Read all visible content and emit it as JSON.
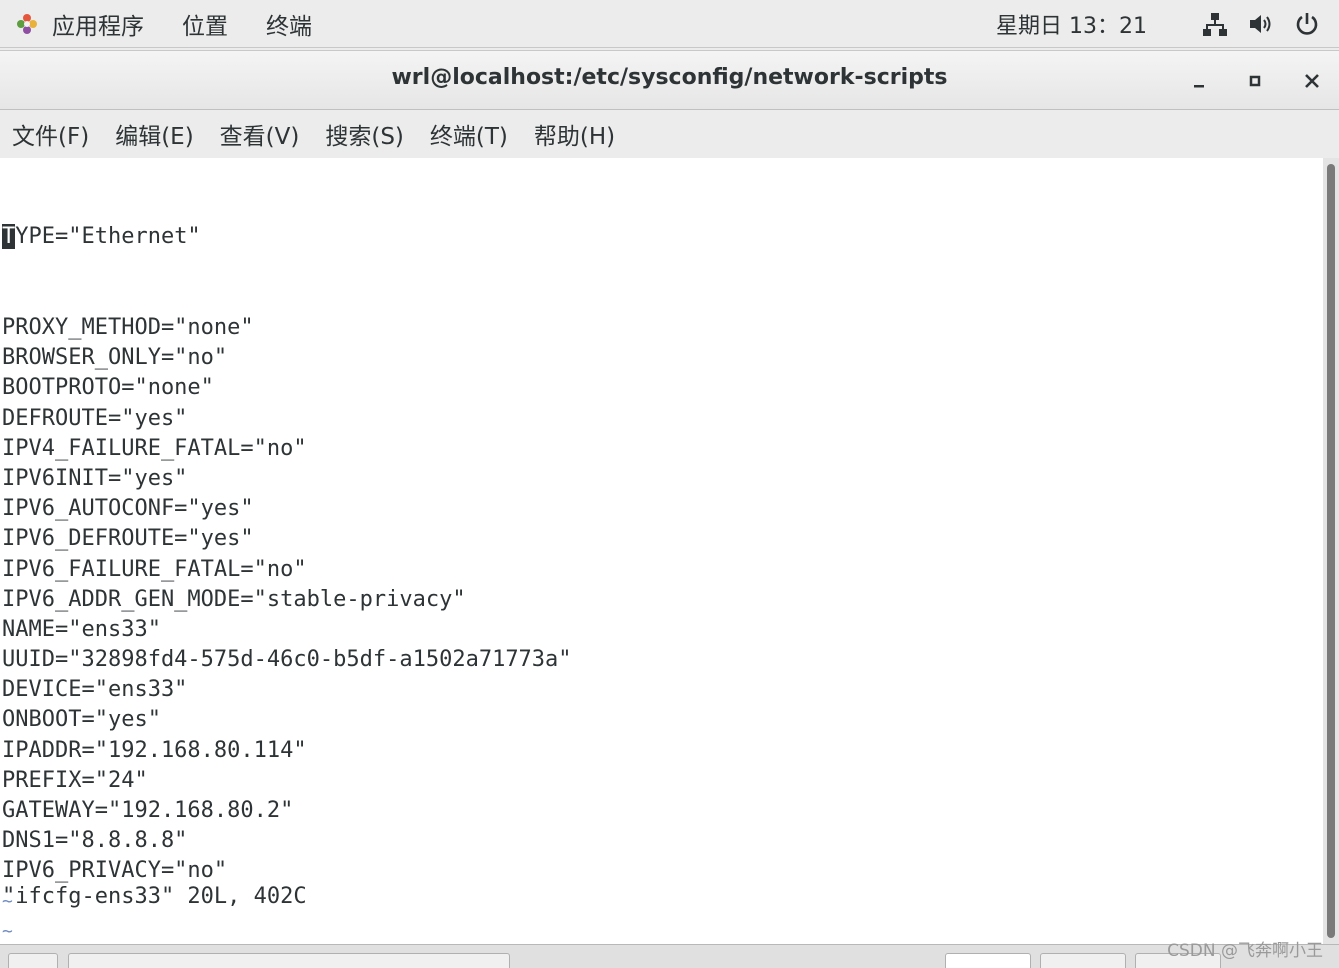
{
  "top_panel": {
    "applications": "应用程序",
    "places": "位置",
    "terminal": "终端",
    "clock": "星期日 13：21",
    "icons": [
      "network-icon",
      "volume-icon",
      "power-icon"
    ]
  },
  "window": {
    "title": "wrl@localhost:/etc/sysconfig/network-scripts"
  },
  "menubar": {
    "file": "文件(F)",
    "edit": "编辑(E)",
    "view": "查看(V)",
    "search": "搜索(S)",
    "terminal": "终端(T)",
    "help": "帮助(H)"
  },
  "terminal": {
    "first_char": "T",
    "first_rest": "YPE=\"Ethernet\"",
    "lines": [
      "PROXY_METHOD=\"none\"",
      "BROWSER_ONLY=\"no\"",
      "BOOTPROTO=\"none\"",
      "DEFROUTE=\"yes\"",
      "IPV4_FAILURE_FATAL=\"no\"",
      "IPV6INIT=\"yes\"",
      "IPV6_AUTOCONF=\"yes\"",
      "IPV6_DEFROUTE=\"yes\"",
      "IPV6_FAILURE_FATAL=\"no\"",
      "IPV6_ADDR_GEN_MODE=\"stable-privacy\"",
      "NAME=\"ens33\"",
      "UUID=\"32898fd4-575d-46c0-b5df-a1502a71773a\"",
      "DEVICE=\"ens33\"",
      "ONBOOT=\"yes\"",
      "IPADDR=\"192.168.80.114\"",
      "PREFIX=\"24\"",
      "GATEWAY=\"192.168.80.2\"",
      "DNS1=\"8.8.8.8\"",
      "IPV6_PRIVACY=\"no\""
    ],
    "tildes": [
      "~",
      "~",
      "~",
      "~"
    ],
    "status": "\"ifcfg-ens33\" 20L, 402C"
  },
  "watermark": "CSDN @飞奔啊小王"
}
